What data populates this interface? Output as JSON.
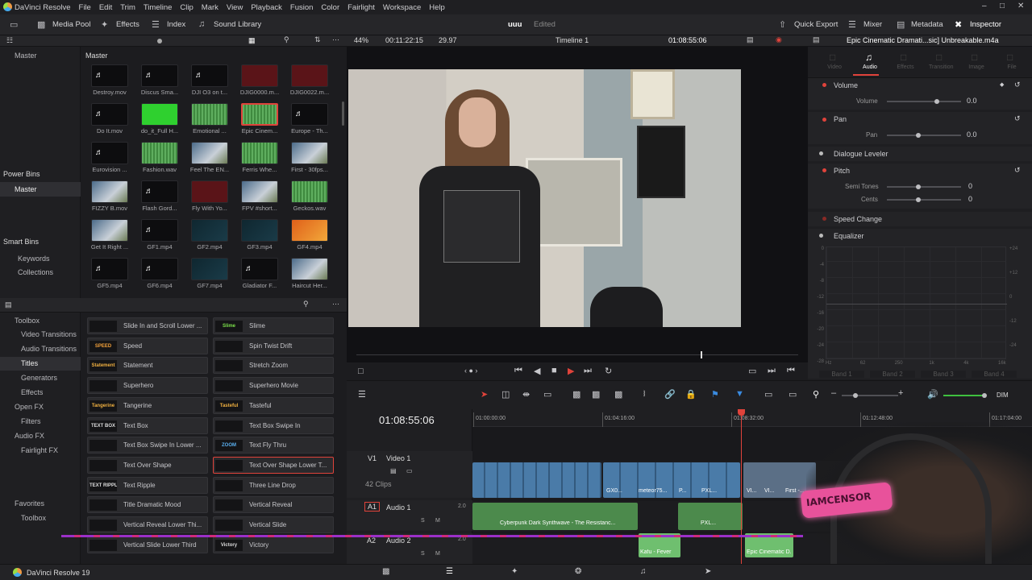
{
  "menubar": {
    "app_name": "DaVinci Resolve",
    "items": [
      "File",
      "Edit",
      "Trim",
      "Timeline",
      "Clip",
      "Mark",
      "View",
      "Playback",
      "Fusion",
      "Color",
      "Fairlight",
      "Workspace",
      "Help"
    ]
  },
  "toolbar": {
    "media_pool": "Media Pool",
    "effects": "Effects",
    "index": "Index",
    "sound_library": "Sound Library",
    "project_name": "uuu",
    "project_status": "Edited",
    "quick_export": "Quick Export",
    "mixer": "Mixer",
    "metadata": "Metadata",
    "inspector": "Inspector"
  },
  "media_pool": {
    "bin_title": "Master",
    "sidebar_master": "Master",
    "power_bins": "Power Bins",
    "power_bins_master": "Master",
    "smart_bins": "Smart Bins",
    "keywords": "Keywords",
    "collections": "Collections",
    "clips": [
      {
        "name": "Destroy.mov",
        "kind": "audio"
      },
      {
        "name": "Discus Sma...",
        "kind": "audio"
      },
      {
        "name": "DJI O3 on t...",
        "kind": "audio"
      },
      {
        "name": "DJIG0000.m...",
        "kind": "red"
      },
      {
        "name": "DJIG0022.m...",
        "kind": "red"
      },
      {
        "name": "Do It.mov",
        "kind": "audio"
      },
      {
        "name": "do_it_Full H...",
        "kind": "green"
      },
      {
        "name": "Emotional ...",
        "kind": "wave"
      },
      {
        "name": "Epic Cinem...",
        "kind": "wave-sel"
      },
      {
        "name": "Europe - Th...",
        "kind": "audio"
      },
      {
        "name": "Eurovision ...",
        "kind": "audio"
      },
      {
        "name": "Fashion.wav",
        "kind": "wave"
      },
      {
        "name": "Feel The EN...",
        "kind": "video"
      },
      {
        "name": "Ferris Whe...",
        "kind": "wave"
      },
      {
        "name": "First - 30fps...",
        "kind": "video"
      },
      {
        "name": "FIZZY B.mov",
        "kind": "video"
      },
      {
        "name": "Flash Gord...",
        "kind": "audio"
      },
      {
        "name": "Fly With Yo...",
        "kind": "red"
      },
      {
        "name": "FPV #short...",
        "kind": "video"
      },
      {
        "name": "Geckos.wav",
        "kind": "wave"
      },
      {
        "name": "Get It Right ...",
        "kind": "video"
      },
      {
        "name": "GF1.mp4",
        "kind": "audio"
      },
      {
        "name": "GF2.mp4",
        "kind": "dark"
      },
      {
        "name": "GF3.mp4",
        "kind": "dark"
      },
      {
        "name": "GF4.mp4",
        "kind": "fire"
      },
      {
        "name": "GF5.mp4",
        "kind": "audio"
      },
      {
        "name": "GF6.mp4",
        "kind": "audio"
      },
      {
        "name": "GF7.mp4",
        "kind": "dark"
      },
      {
        "name": "Gladiator F...",
        "kind": "audio"
      },
      {
        "name": "Haircut Her...",
        "kind": "video"
      }
    ]
  },
  "effects_sidebar": {
    "toolbox": "Toolbox",
    "video_transitions": "Video Transitions",
    "audio_transitions": "Audio Transitions",
    "titles": "Titles",
    "generators": "Generators",
    "effects": "Effects",
    "open_fx": "Open FX",
    "filters": "Filters",
    "audio_fx": "Audio FX",
    "fairlight_fx": "Fairlight FX",
    "favorites": "Favorites",
    "fav_toolbox": "Toolbox"
  },
  "titles": [
    {
      "label": "Slide In and Scroll Lower ...",
      "thumb": ""
    },
    {
      "label": "Slime",
      "thumb": "Slime"
    },
    {
      "label": "Speed",
      "thumb": "SPEED"
    },
    {
      "label": "Spin Twist Drift",
      "thumb": ""
    },
    {
      "label": "Statement",
      "thumb": "Statement"
    },
    {
      "label": "Stretch Zoom",
      "thumb": ""
    },
    {
      "label": "Superhero",
      "thumb": ""
    },
    {
      "label": "Superhero Movie",
      "thumb": ""
    },
    {
      "label": "Tangerine",
      "thumb": "Tangerine"
    },
    {
      "label": "Tasteful",
      "thumb": "Tasteful"
    },
    {
      "label": "Text Box",
      "thumb": "TEXT BOX"
    },
    {
      "label": "Text Box Swipe In",
      "thumb": ""
    },
    {
      "label": "Text Box Swipe In Lower ...",
      "thumb": ""
    },
    {
      "label": "Text Fly Thru",
      "thumb": "ZOOM"
    },
    {
      "label": "Text Over Shape",
      "thumb": ""
    },
    {
      "label": "Text Over Shape Lower T...",
      "thumb": ""
    },
    {
      "label": "Text Ripple",
      "thumb": "TEXT RIPPLE"
    },
    {
      "label": "Three Line Drop",
      "thumb": ""
    },
    {
      "label": "Title Dramatic Mood",
      "thumb": ""
    },
    {
      "label": "Vertical Reveal",
      "thumb": ""
    },
    {
      "label": "Vertical Reveal Lower Thi...",
      "thumb": ""
    },
    {
      "label": "Vertical Slide",
      "thumb": ""
    },
    {
      "label": "Vertical Slide Lower Third",
      "thumb": ""
    },
    {
      "label": "Victory",
      "thumb": "Victory"
    }
  ],
  "viewer": {
    "zoom": "44%",
    "source_timecode": "00:11:22:15",
    "fps": "29.97",
    "timeline_name": "Timeline 1",
    "record_timecode": "01:08:55:06",
    "clip_title": "Epic Cinematic Dramati...sic]  Unbreakable.m4a"
  },
  "inspector": {
    "tabs": [
      "Video",
      "Audio",
      "Effects",
      "Transition",
      "Image",
      "File"
    ],
    "active_tab": "Audio",
    "volume": "Volume",
    "volume_label": "Volume",
    "volume_value": "0.0",
    "pan": "Pan",
    "pan_label": "Pan",
    "pan_value": "0.0",
    "dialogue_leveler": "Dialogue Leveler",
    "pitch": "Pitch",
    "semi_tones": "Semi Tones",
    "semi_tones_value": "0",
    "cents": "Cents",
    "cents_value": "0",
    "speed_change": "Speed Change",
    "equalizer": "Equalizer",
    "eq_bands": [
      "Band 1",
      "Band 2",
      "Band 3",
      "Band 4"
    ],
    "eq_left_scale": [
      "0",
      "-4",
      "-8",
      "-12",
      "-16",
      "-20",
      "-24",
      "-28"
    ],
    "eq_right_scale": [
      "+24",
      "+12",
      "0",
      "-12",
      "-24"
    ],
    "eq_x_scale": [
      "Hz",
      "62",
      "250",
      "1k",
      "4k",
      "16k"
    ]
  },
  "timeline": {
    "timecode": "01:08:55:06",
    "ruler": [
      "01:00:00:00",
      "01:04:16:00",
      "01:08:32:00",
      "01:12:48:00",
      "01:17:04:00"
    ],
    "v1_id": "V1",
    "v1_name": "Video 1",
    "v1_clips": "42 Clips",
    "a1_id": "A1",
    "a1_name": "Audio 1",
    "a1_level": "2.0",
    "a2_id": "A2",
    "a2_name": "Audio 2",
    "a2_level": "2.0",
    "video_clip_labels": [
      "GX0...",
      "meteor75...",
      "P...",
      "PXL...",
      "VI...",
      "VI...",
      "First -..."
    ],
    "audio1_clip": "Cyberpunk Dark Synthwave - The Resistanc...",
    "audio1_clip2": "PXL...",
    "audio2_clip": "Kafu - Fever",
    "audio2_clip2": "Epic Cinematic D...",
    "dim": "DIM",
    "track_s": "S",
    "track_m": "M"
  },
  "overlay": {
    "mic_sign": "IAMCENSOR"
  },
  "statusbar": {
    "app_version": "DaVinci Resolve 19"
  },
  "colors": {
    "accent_red": "#e0433b",
    "video_clip": "#4a7ba8",
    "audio_clip": "#4c8a4c",
    "audio_clip2": "#6fbf6f",
    "selection_border": "#e0433b"
  }
}
